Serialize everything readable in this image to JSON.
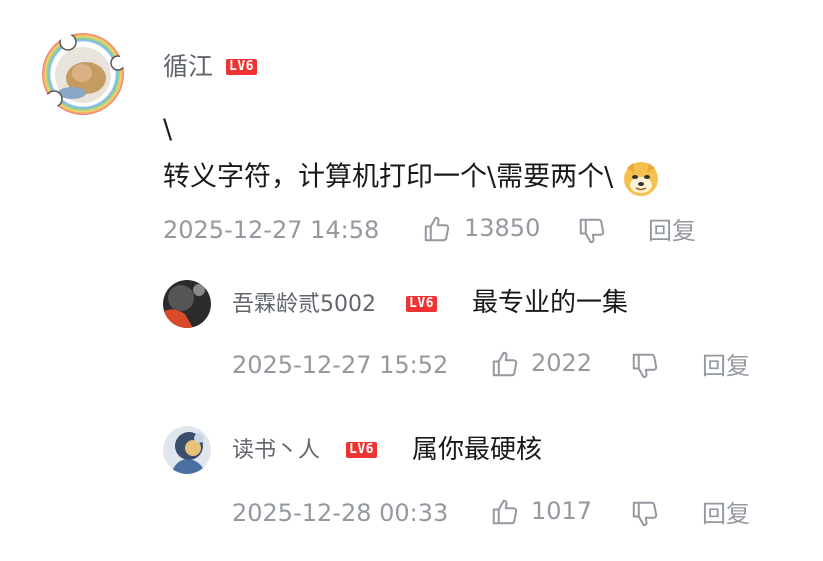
{
  "comment": {
    "username": "循江",
    "level": "LV6",
    "line1": "\\",
    "line2": "转义字符，计算机打印一个\\需要两个\\",
    "emoji": "doge-emoji",
    "time": "2025-12-27 14:58",
    "likes": "13850",
    "reply": "回复"
  },
  "replies": [
    {
      "username": "吾霖龄贰5002",
      "level": "LV6",
      "text": "最专业的一集",
      "time": "2025-12-27 15:52",
      "likes": "2022",
      "reply": "回复"
    },
    {
      "username": "读书丶人",
      "level": "LV6",
      "text": "属你最硬核",
      "time": "2025-12-28 00:33",
      "likes": "1017",
      "reply": "回复"
    }
  ],
  "colors": {
    "level_badge": "#ee3333",
    "meta_gray": "#9499a0",
    "text_dark": "#18191c"
  }
}
